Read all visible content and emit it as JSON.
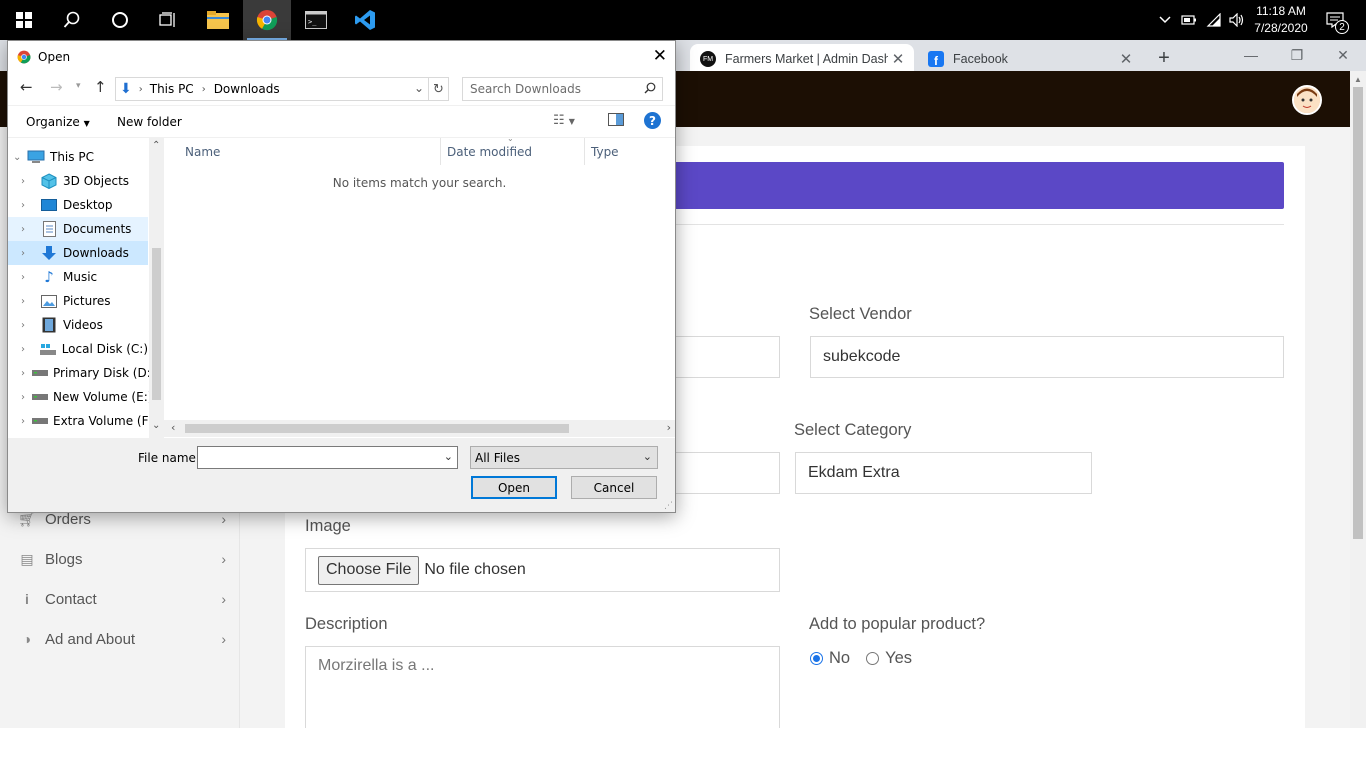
{
  "taskbar": {
    "clock_time": "11:18 AM",
    "clock_date": "7/28/2020",
    "notification_count": "2"
  },
  "browser": {
    "tabs": [
      {
        "title": "Farmers Market | Admin Dashb",
        "favicon": "FM",
        "active": true
      },
      {
        "title": "Facebook",
        "favicon": "f",
        "active": false
      }
    ]
  },
  "sidebar": {
    "items": [
      {
        "label": "Orders",
        "icon": "cart-icon"
      },
      {
        "label": "Blogs",
        "icon": "blog-icon"
      },
      {
        "label": "Contact",
        "icon": "info-icon"
      },
      {
        "label": "Ad and About",
        "icon": "pie-icon"
      }
    ]
  },
  "form": {
    "vendor_label": "Select Vendor",
    "vendor_value": "subekcode",
    "category_label": "Select Category",
    "category_value": "Ekdam Extra",
    "image_label": "Image",
    "choose_file_label": "Choose File",
    "no_file_text": "No file chosen",
    "description_label": "Description",
    "description_placeholder": "Morzirella is a ...",
    "popular_label": "Add to popular product?",
    "popular_options": [
      "No",
      "Yes"
    ],
    "popular_selected": "No"
  },
  "dialog": {
    "title": "Open",
    "path": [
      "This PC",
      "Downloads"
    ],
    "search_placeholder": "Search Downloads",
    "organize_label": "Organize",
    "new_folder_label": "New folder",
    "nav_items": [
      {
        "label": "This PC",
        "icon": "pc-icon"
      },
      {
        "label": "3D Objects",
        "icon": "cube-icon"
      },
      {
        "label": "Desktop",
        "icon": "desktop-icon"
      },
      {
        "label": "Documents",
        "icon": "documents-icon"
      },
      {
        "label": "Downloads",
        "icon": "download-icon"
      },
      {
        "label": "Music",
        "icon": "music-icon"
      },
      {
        "label": "Pictures",
        "icon": "pictures-icon"
      },
      {
        "label": "Videos",
        "icon": "videos-icon"
      },
      {
        "label": "Local Disk (C:)",
        "icon": "drive-icon"
      },
      {
        "label": "Primary Disk (D:)",
        "icon": "drive-icon"
      },
      {
        "label": "New Volume (E:)",
        "icon": "drive-icon"
      },
      {
        "label": "Extra Volume (F:)",
        "icon": "drive-icon"
      }
    ],
    "columns": [
      "Name",
      "Date modified",
      "Type"
    ],
    "empty_message": "No items match your search.",
    "file_name_label": "File name:",
    "file_name_value": "",
    "file_type_value": "All Files",
    "open_label": "Open",
    "cancel_label": "Cancel"
  }
}
